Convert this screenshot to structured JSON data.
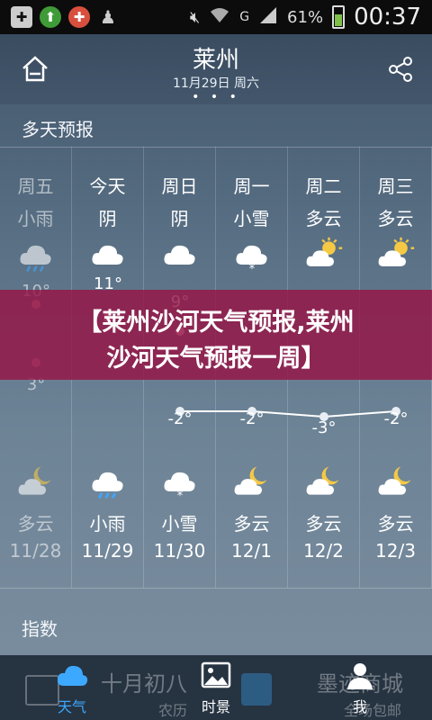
{
  "status_bar": {
    "battery_percent": "61%",
    "time": "00:37",
    "network": "G",
    "left_icons": [
      "add-icon",
      "upload-icon",
      "game-icon",
      "qq-icon"
    ],
    "right_icons": [
      "mute-icon",
      "wifi-icon",
      "signal-icon",
      "battery-icon"
    ]
  },
  "header": {
    "city": "莱州",
    "date": "11月29日 周六",
    "page_dots": "• • •"
  },
  "forecast": {
    "title": "多天预报",
    "days": [
      {
        "day": "周五",
        "cond": "小雨",
        "icon": "rain-cloud-icon",
        "hi": "10°",
        "lo": "3°",
        "night_icon": "partly-cloudy-night-icon",
        "night_cond": "多云",
        "date": "11/28",
        "past": true
      },
      {
        "day": "今天",
        "cond": "阴",
        "icon": "cloud-icon",
        "hi": "11°",
        "lo": "",
        "night_icon": "rain-cloud-icon",
        "night_cond": "小雨",
        "date": "11/29",
        "past": false
      },
      {
        "day": "周日",
        "cond": "阴",
        "icon": "cloud-icon",
        "hi": "9°",
        "lo": "-2°",
        "night_icon": "snow-cloud-icon",
        "night_cond": "小雪",
        "date": "11/30",
        "past": false
      },
      {
        "day": "周一",
        "cond": "小雪",
        "icon": "snow-cloud-icon",
        "hi": "",
        "lo": "-2°",
        "night_icon": "partly-cloudy-night-icon",
        "night_cond": "多云",
        "date": "12/1",
        "past": false
      },
      {
        "day": "周二",
        "cond": "多云",
        "icon": "partly-sunny-icon",
        "hi": "",
        "lo": "-3°",
        "night_icon": "partly-cloudy-night-icon",
        "night_cond": "多云",
        "date": "12/2",
        "past": false
      },
      {
        "day": "周三",
        "cond": "多云",
        "icon": "partly-sunny-icon",
        "hi": "",
        "lo": "-2°",
        "night_icon": "partly-cloudy-night-icon",
        "night_cond": "多云",
        "date": "12/3",
        "past": false
      }
    ]
  },
  "banner": {
    "line1": "【莱州沙河天气预报,莱州",
    "line2": "沙河天气预报一周】"
  },
  "index_section": {
    "title": "指数"
  },
  "bottom_bar": {
    "tabs": [
      {
        "label": "天气",
        "icon": "cloud-icon",
        "active": true
      },
      {
        "label": "时景",
        "icon": "image-icon",
        "active": false
      },
      {
        "label": "我",
        "icon": "person-icon",
        "active": false
      }
    ],
    "bg_texts": {
      "lunar": "十月初八",
      "lunar_label": "农历",
      "mall": "墨迹商城",
      "mall_sub": "全场包邮"
    }
  },
  "colors": {
    "accent": "#3da8ff",
    "banner": "#961446"
  }
}
